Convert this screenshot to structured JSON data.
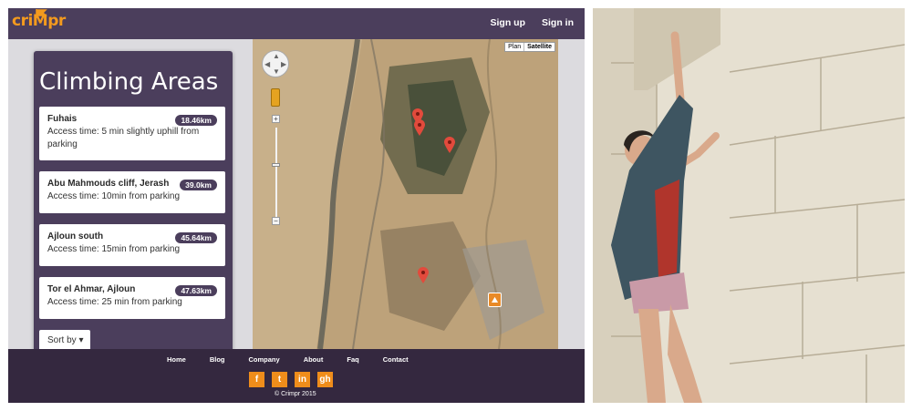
{
  "brand": {
    "logo": "criMpr",
    "accent": "#f39a1e"
  },
  "nav": {
    "signup": "Sign up",
    "signin": "Sign in"
  },
  "areas": {
    "title": "Climbing Areas",
    "items": [
      {
        "name": "Fuhais",
        "distance": "18.46km",
        "access": "Access time: 5 min slightly uphill from parking"
      },
      {
        "name": "Abu Mahmouds cliff, Jerash",
        "distance": "39.0km",
        "access": "Access time: 10min from parking"
      },
      {
        "name": "Ajloun south",
        "distance": "45.64km",
        "access": "Access time: 15min from parking"
      },
      {
        "name": "Tor el Ahmar, Ajloun",
        "distance": "47.63km",
        "access": "Access time: 25 min from parking"
      }
    ],
    "sort_label": "Sort by ▾"
  },
  "map": {
    "type_plan": "Plan",
    "type_satellite": "Satellite",
    "zoom_in": "+",
    "zoom_out": "−"
  },
  "footer": {
    "links": [
      "Home",
      "Blog",
      "Company",
      "About",
      "Faq",
      "Contact"
    ],
    "social": [
      {
        "label": "f",
        "icon": "facebook-icon"
      },
      {
        "label": "t",
        "icon": "twitter-icon"
      },
      {
        "label": "in",
        "icon": "linkedin-icon"
      },
      {
        "label": "gh",
        "icon": "github-icon"
      }
    ],
    "copyright": "© Crimpr 2015"
  },
  "colors": {
    "header": "#4b3e5c",
    "footer": "#34283f",
    "social": "#ef8d1b"
  }
}
